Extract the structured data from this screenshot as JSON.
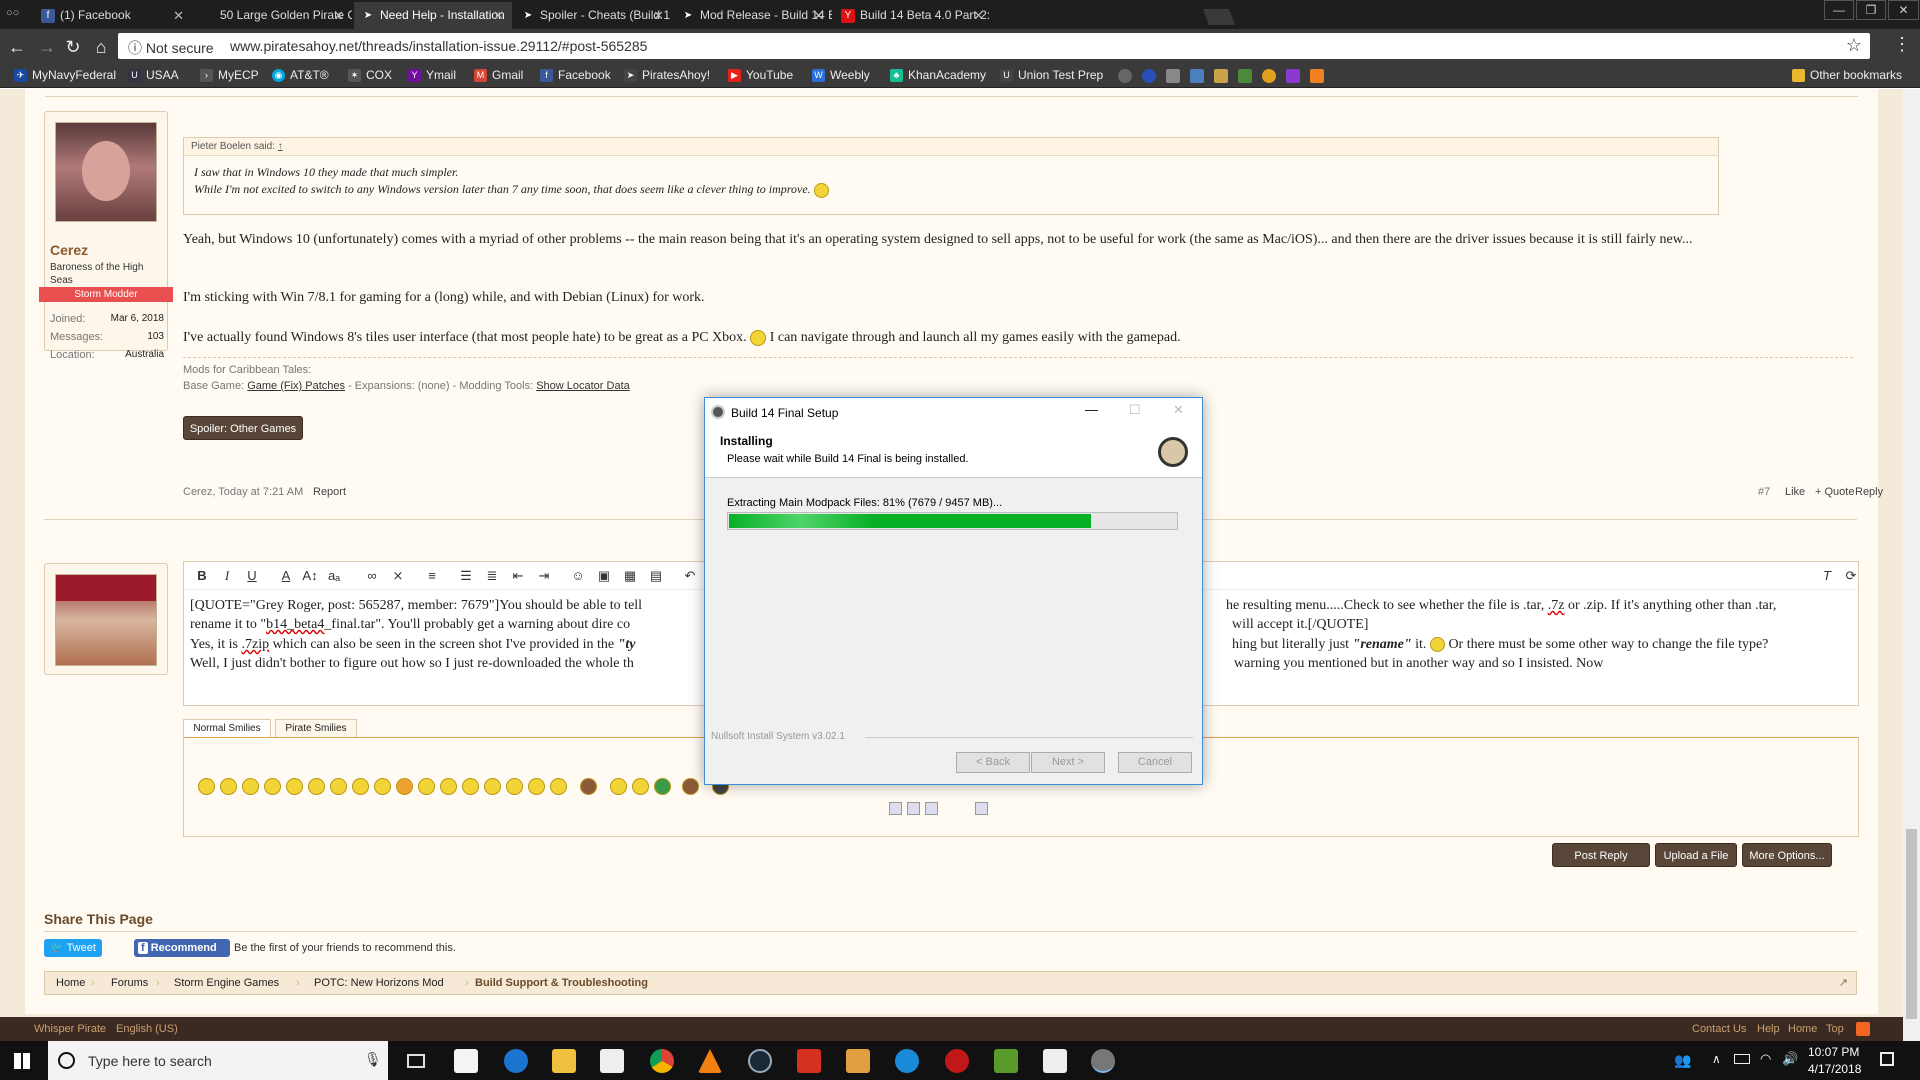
{
  "browser": {
    "tabs": [
      {
        "label": "(1) Facebook",
        "icon": "facebook-icon",
        "color": "#3b5998"
      },
      {
        "label": "50 Large Golden Pirate C",
        "icon": "blank-icon",
        "color": "#555"
      },
      {
        "label": "Need Help - Installation",
        "icon": "piratesahoy-icon",
        "color": "#333",
        "active": true
      },
      {
        "label": "Spoiler - Cheats (Build 1",
        "icon": "piratesahoy-icon",
        "color": "#333"
      },
      {
        "label": "Mod Release - Build 14 B",
        "icon": "piratesahoy-icon",
        "color": "#333"
      },
      {
        "label": "Build 14 Beta 4.0 Part 2:",
        "icon": "yahoo-icon",
        "color": "#720e9e"
      }
    ],
    "security": "Not secure",
    "url": "www.piratesahoy.net/threads/installation-issue.29112/#post-565285",
    "bookmarks": [
      {
        "label": "MyNavyFederal",
        "color": "#1a4aa0"
      },
      {
        "label": "USAA",
        "color": "#334"
      },
      {
        "label": "MyECP",
        "color": "#555"
      },
      {
        "label": "AT&T®",
        "color": "#00a8e0"
      },
      {
        "label": "COX",
        "color": "#555"
      },
      {
        "label": "Ymail",
        "color": "#720e9e"
      },
      {
        "label": "Gmail",
        "color": "#d44638"
      },
      {
        "label": "Facebook",
        "color": "#3b5998"
      },
      {
        "label": "PiratesAhoy!",
        "color": "#444"
      },
      {
        "label": "YouTube",
        "color": "#e62117"
      },
      {
        "label": "Weebly",
        "color": "#2a6fdb"
      },
      {
        "label": "KhanAcademy",
        "color": "#14bf96"
      },
      {
        "label": "Union Test Prep",
        "color": "#444"
      }
    ],
    "other_bookmarks": "Other bookmarks"
  },
  "post": {
    "author": "Cerez",
    "title": "Baroness of the High Seas",
    "banner": "Storm Modder",
    "stats": [
      {
        "label": "Joined:",
        "value": "Mar 6, 2018"
      },
      {
        "label": "Messages:",
        "value": "103"
      },
      {
        "label": "Location:",
        "value": "Australia"
      }
    ],
    "quote_author": "Pieter Boelen said:",
    "quote_arrow": "↑",
    "quote_lines": [
      "I saw that in Windows 10 they made that much simpler.",
      "While I'm not excited to switch to any Windows version later than 7 any time soon, that does seem like a clever thing to improve."
    ],
    "paragraphs": [
      "Yeah, but Windows 10 (unfortunately) comes with a myriad of other problems -- the main reason being that it's an operating system designed to sell apps, not to be useful for work (the same as Mac/iOS)... and then there are the driver issues because it is still fairly new...",
      "I'm sticking with Win 7/8.1 for gaming for a (long) while, and with Debian (Linux) for work.",
      "I've actually found Windows 8's tiles user interface (that most people hate) to be great as a PC Xbox.",
      "I can navigate through and launch all my games easily with the gamepad."
    ],
    "sig_title": "Mods for Caribbean Tales:",
    "sig_base": "Base Game:",
    "sig_base_link": "Game (Fix) Patches",
    "sig_exp": " - Expansions: (none) - Modding Tools:",
    "sig_tool_link": "Show Locator Data",
    "spoiler_button": "Spoiler: Other Games",
    "meta_author": "Cerez, Today at 7:21 AM",
    "report": "Report",
    "post_number": "#7",
    "like": "Like",
    "quote": "+ Quote",
    "reply": "Reply"
  },
  "editor": {
    "line1a": "[QUOTE=\"Grey Roger, post: 565287, member: 7679\"]You should be able to tell",
    "line1b": "he resulting menu.....Check to see whether the file is .tar,",
    "line1c": ".7z",
    "line1d": "or .zip.  If it's anything other than .tar,",
    "line2a": "rename it to \"",
    "line2b": "b14_beta4",
    "line2c": "_final.tar\".  You'll probably get a warning about dire co",
    "line2d": "will accept it.[/QUOTE]",
    "line3a": "Yes, it is",
    "line3b": ".7zip",
    "line3c": "which can also be seen in the screen shot I've provided in the",
    "line3d": "\"ty",
    "line3e": "hing but literally just",
    "line3f": "\"rename\"",
    "line3g": "it.",
    "line3h": "Or there must be some other way to change the file type?",
    "line4a": "Well, I just didn't bother to figure out how so I just re-downloaded the whole th",
    "line4b": "warning you mentioned but in another way and so I insisted. Now",
    "smilie_tabs": [
      "Normal Smilies",
      "Pirate Smilies"
    ],
    "buttons": [
      "Post Reply",
      "Upload a File",
      "More Options..."
    ]
  },
  "share": {
    "heading": "Share This Page",
    "tweet": "Tweet",
    "recommend": "Recommend",
    "recommend_text": "Be the first of your friends to recommend this."
  },
  "breadcrumb": [
    "Home",
    "Forums",
    "Storm Engine Games",
    "POTC: New Horizons Mod",
    "Build Support & Troubleshooting"
  ],
  "footer": {
    "left": [
      "Whisper Pirate",
      "English (US)"
    ],
    "right": [
      "Contact Us",
      "Help",
      "Home",
      "Top"
    ]
  },
  "installer": {
    "title": "Build 14 Final Setup",
    "heading": "Installing",
    "subheading": "Please wait while Build 14 Final is being installed.",
    "status": "Extracting Main Modpack Files: 81% (7679 / 9457 MB)...",
    "progress": 0.81,
    "brand": "Nullsoft Install System v3.02.1",
    "back": "< Back",
    "next": "Next >",
    "cancel": "Cancel"
  },
  "taskbar": {
    "search_placeholder": "Type here to search",
    "time": "10:07 PM",
    "date": "4/17/2018"
  }
}
